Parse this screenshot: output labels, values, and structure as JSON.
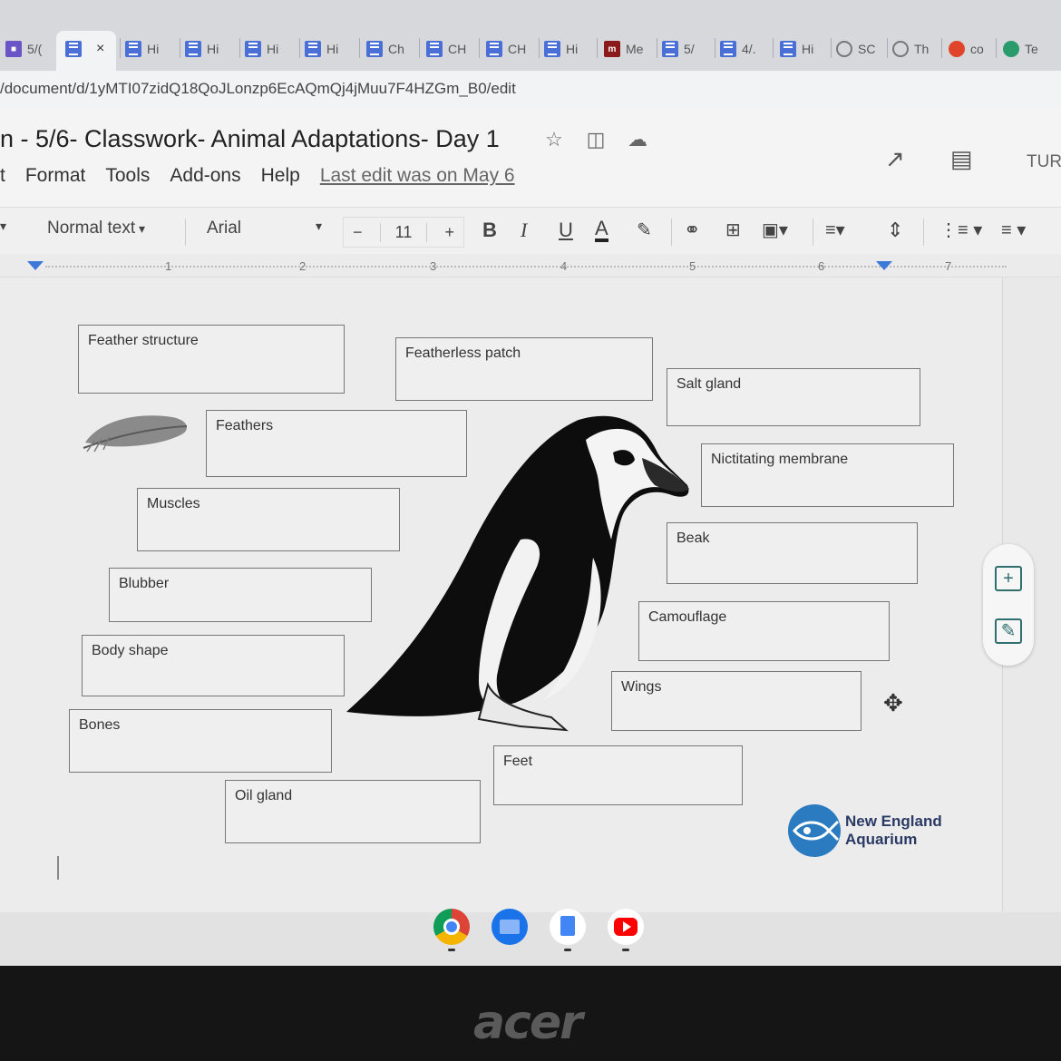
{
  "tabs": [
    {
      "label": "5/(",
      "icon": "classroom-icon"
    },
    {
      "label": "",
      "icon": "doc-icon",
      "active": true
    },
    {
      "label": "Hi",
      "icon": "doc-icon"
    },
    {
      "label": "Hi",
      "icon": "doc-icon"
    },
    {
      "label": "Hi",
      "icon": "doc-icon"
    },
    {
      "label": "Hi",
      "icon": "doc-icon"
    },
    {
      "label": "Ch",
      "icon": "doc-icon"
    },
    {
      "label": "CH",
      "icon": "doc-icon"
    },
    {
      "label": "CH",
      "icon": "doc-icon"
    },
    {
      "label": "Hi",
      "icon": "doc-icon"
    },
    {
      "label": "Me",
      "icon": "meet-icon"
    },
    {
      "label": "5/",
      "icon": "doc-icon"
    },
    {
      "label": "4/.",
      "icon": "doc-icon"
    },
    {
      "label": "Hi",
      "icon": "doc-icon"
    },
    {
      "label": "SC",
      "icon": "circle-icon"
    },
    {
      "label": "Th",
      "icon": "circle-icon"
    },
    {
      "label": "co",
      "icon": "reddit-icon"
    },
    {
      "label": "Te",
      "icon": "green-icon"
    }
  ],
  "tab_close": "×",
  "address": {
    "url": "/document/d/1yMTI07zidQ18QoJLonzp6EcAQmQj4jMuu7F4HZGm_B0/edit"
  },
  "doc": {
    "title": "n - 5/6- Classwork- Animal Adaptations- Day 1",
    "menu": [
      "t",
      "Format",
      "Tools",
      "Add-ons",
      "Help"
    ],
    "last_edit": "Last edit was on May 6",
    "turn_label": "TUR"
  },
  "toolbar": {
    "style": "Normal text",
    "font": "Arial",
    "font_size": "11",
    "minus": "−",
    "plus": "+",
    "bold": "B",
    "italic": "I",
    "underline": "U",
    "text_color": "A"
  },
  "ruler": {
    "ticks": [
      "1",
      "2",
      "3",
      "4",
      "5",
      "6",
      "7"
    ]
  },
  "labels": [
    {
      "id": "feather-structure",
      "text": "Feather structure"
    },
    {
      "id": "featherless-patch",
      "text": "Featherless patch"
    },
    {
      "id": "salt-gland",
      "text": "Salt gland"
    },
    {
      "id": "feathers",
      "text": "Feathers"
    },
    {
      "id": "nictitating-membrane",
      "text": "Nictitating membrane"
    },
    {
      "id": "muscles",
      "text": "Muscles"
    },
    {
      "id": "beak",
      "text": "Beak"
    },
    {
      "id": "blubber",
      "text": "Blubber"
    },
    {
      "id": "camouflage",
      "text": "Camouflage"
    },
    {
      "id": "body-shape",
      "text": "Body shape"
    },
    {
      "id": "wings",
      "text": "Wings"
    },
    {
      "id": "bones",
      "text": "Bones"
    },
    {
      "id": "feet",
      "text": "Feet"
    },
    {
      "id": "oil-gland",
      "text": "Oil gland"
    }
  ],
  "logo": {
    "line1": "New England",
    "line2": "Aquarium"
  },
  "shelf": [
    "chrome-icon",
    "files-icon",
    "docs-icon",
    "youtube-icon"
  ],
  "brand": "acer",
  "colors": {
    "accent": "#3c78d8",
    "doc_blue": "#4a6fd6",
    "logo_blue": "#2a7bbf"
  }
}
